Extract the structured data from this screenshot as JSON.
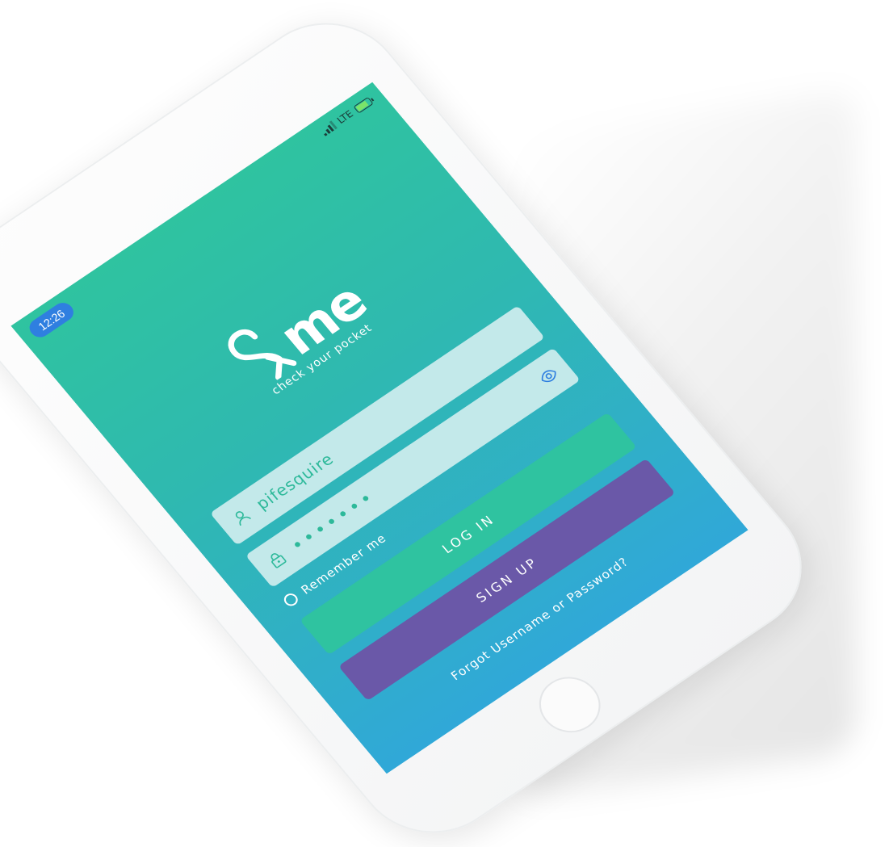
{
  "status_bar": {
    "time": "12:26",
    "network": "LTE"
  },
  "logo": {
    "word": "me",
    "tagline": "check your pocket"
  },
  "login_form": {
    "username_value": "pifesquire",
    "password_value": "•••••••",
    "remember_label": "Remember me",
    "remember_checked": false,
    "login_label": "LOG IN",
    "signup_label": "SIGN UP",
    "forgot_label": "Forgot Username or Password?"
  },
  "colors": {
    "gradient_top": "#2fc3a0",
    "gradient_bottom": "#30a8d8",
    "login_button": "#2fc3a0",
    "signup_button": "#6a58a8",
    "field_background": "#c3e9ea",
    "time_pill": "#2f7fe0"
  },
  "icons": {
    "username": "user-icon",
    "password": "lock-icon",
    "show_password": "eye-icon",
    "signal": "signal-icon",
    "battery": "battery-charging-icon"
  }
}
